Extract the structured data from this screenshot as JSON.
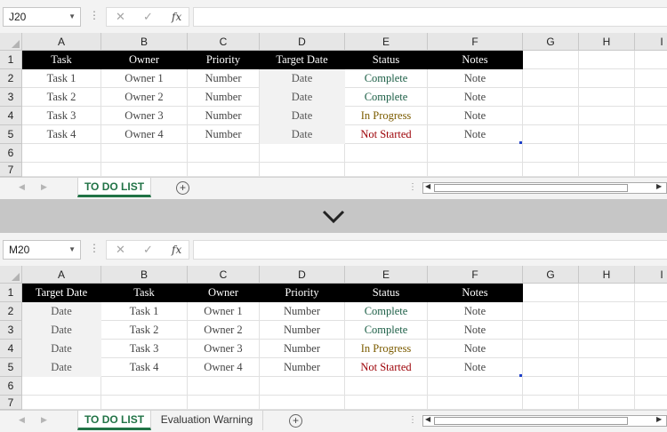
{
  "column_letters": [
    "A",
    "B",
    "C",
    "D",
    "E",
    "F",
    "G",
    "H",
    "I"
  ],
  "row_numbers": [
    "1",
    "2",
    "3",
    "4",
    "5",
    "6",
    "7"
  ],
  "formula_bar": {
    "dropdown_icon": "dropdown-arrow-icon",
    "cancel_icon": "cancel-x-icon",
    "enter_icon": "checkmark-icon",
    "fx_label": "fx",
    "formula_value": ""
  },
  "top": {
    "name_box": "J20",
    "header": [
      "Task",
      "Owner",
      "Priority",
      "Target Date",
      "Status",
      "Notes"
    ],
    "rows": [
      [
        "Task 1",
        "Owner 1",
        "Number",
        "Date",
        "Complete",
        "Note"
      ],
      [
        "Task 2",
        "Owner 2",
        "Number",
        "Date",
        "Complete",
        "Note"
      ],
      [
        "Task 3",
        "Owner 3",
        "Number",
        "Date",
        "In Progress",
        "Note"
      ],
      [
        "Task 4",
        "Owner 4",
        "Number",
        "Date",
        "Not Started",
        "Note"
      ]
    ],
    "shaded_column": "Target Date",
    "tabs": [
      "TO DO LIST"
    ]
  },
  "bottom": {
    "name_box": "M20",
    "header": [
      "Target Date",
      "Task",
      "Owner",
      "Priority",
      "Status",
      "Notes"
    ],
    "rows": [
      [
        "Date",
        "Task 1",
        "Owner 1",
        "Number",
        "Complete",
        "Note"
      ],
      [
        "Date",
        "Task 2",
        "Owner 2",
        "Number",
        "Complete",
        "Note"
      ],
      [
        "Date",
        "Task 3",
        "Owner 3",
        "Number",
        "In Progress",
        "Note"
      ],
      [
        "Date",
        "Task 4",
        "Owner 4",
        "Number",
        "Not Started",
        "Note"
      ]
    ],
    "shaded_column": "Target Date",
    "tabs": [
      "TO DO LIST",
      "Evaluation Warning"
    ]
  },
  "status_colors": {
    "Complete": "#1b5e45",
    "In Progress": "#7c5c00",
    "Not Started": "#9c0006"
  },
  "header_colors": {
    "background": "#000000",
    "text": "#ffffff"
  },
  "shade_color": "#f2f2f2",
  "accent_color": "#217346",
  "separator_icon": "chevron-down-icon"
}
